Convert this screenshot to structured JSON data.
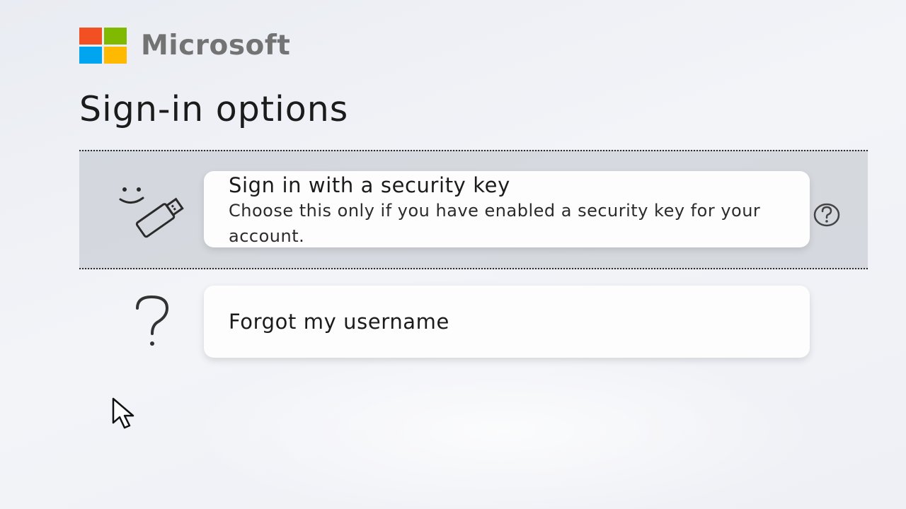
{
  "brand": {
    "name": "Microsoft",
    "colors": {
      "red": "#f25022",
      "green": "#7fba00",
      "blue": "#00a4ef",
      "yellow": "#ffb900"
    }
  },
  "page": {
    "title": "Sign-in options"
  },
  "options": [
    {
      "title": "Sign in with a security key",
      "description": "Choose this only if you have enabled a security key for your account.",
      "icon": "security-key-icon",
      "selected": true,
      "has_help": true
    },
    {
      "title": "Forgot my username",
      "icon": "question-mark-icon",
      "selected": false
    }
  ],
  "help_icon": "help-circle-icon",
  "cursor_icon": "mouse-pointer-icon"
}
